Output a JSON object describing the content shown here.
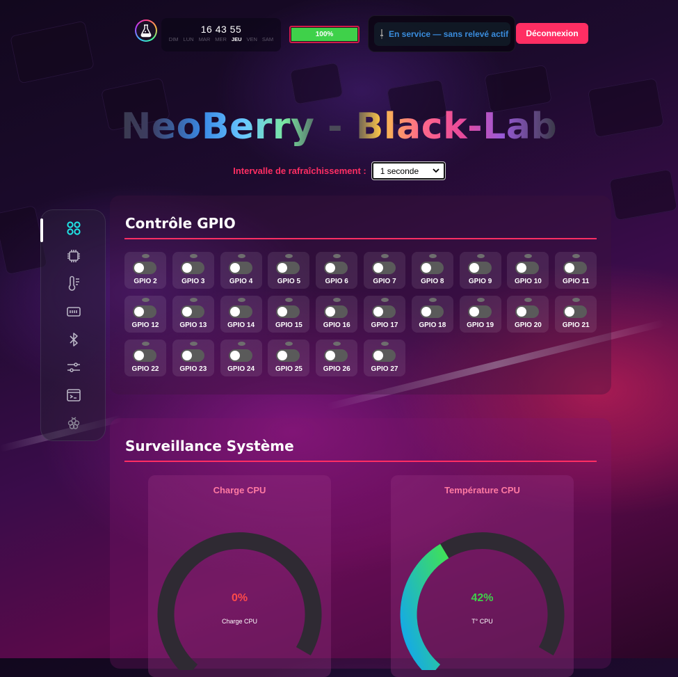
{
  "header": {
    "clock": {
      "time": "16 43 55",
      "days": [
        "DIM",
        "LUN",
        "MAR",
        "MER",
        "JEU",
        "VEN",
        "SAM"
      ],
      "active_day": "JEU"
    },
    "battery": {
      "label": "100%",
      "level": 100
    },
    "status": {
      "text": "En service — sans relevé actif"
    },
    "logout_label": "Déconnexion"
  },
  "title": "NeoBerry - Black-Lab",
  "refresh": {
    "label": "Intervalle de rafraîchissement :",
    "selected": "1 seconde"
  },
  "sidebar": {
    "items": [
      {
        "icon": "dashboard-icon",
        "active": true
      },
      {
        "icon": "chip-icon"
      },
      {
        "icon": "thermometer-icon"
      },
      {
        "icon": "memory-icon"
      },
      {
        "icon": "bluetooth-icon"
      },
      {
        "icon": "sliders-icon"
      },
      {
        "icon": "terminal-icon"
      },
      {
        "icon": "raspberry-icon"
      }
    ]
  },
  "gpio": {
    "title": "Contrôle GPIO",
    "pins": [
      {
        "label": "GPIO 2",
        "on": false
      },
      {
        "label": "GPIO 3",
        "on": false
      },
      {
        "label": "GPIO 4",
        "on": false
      },
      {
        "label": "GPIO 5",
        "on": false
      },
      {
        "label": "GPIO 6",
        "on": false
      },
      {
        "label": "GPIO 7",
        "on": false
      },
      {
        "label": "GPIO 8",
        "on": false
      },
      {
        "label": "GPIO 9",
        "on": false
      },
      {
        "label": "GPIO 10",
        "on": false
      },
      {
        "label": "GPIO 11",
        "on": false
      },
      {
        "label": "GPIO 12",
        "on": false
      },
      {
        "label": "GPIO 13",
        "on": false
      },
      {
        "label": "GPIO 14",
        "on": false
      },
      {
        "label": "GPIO 15",
        "on": false
      },
      {
        "label": "GPIO 16",
        "on": false
      },
      {
        "label": "GPIO 17",
        "on": false
      },
      {
        "label": "GPIO 18",
        "on": false
      },
      {
        "label": "GPIO 19",
        "on": false
      },
      {
        "label": "GPIO 20",
        "on": false
      },
      {
        "label": "GPIO 21",
        "on": false
      },
      {
        "label": "GPIO 22",
        "on": false
      },
      {
        "label": "GPIO 23",
        "on": false
      },
      {
        "label": "GPIO 24",
        "on": false
      },
      {
        "label": "GPIO 25",
        "on": false
      },
      {
        "label": "GPIO 26",
        "on": false
      },
      {
        "label": "GPIO 27",
        "on": false
      }
    ]
  },
  "system": {
    "title": "Surveillance Système",
    "gauges": [
      {
        "title": "Charge CPU",
        "value_text": "0%",
        "value": 0,
        "sublabel": "Charge CPU",
        "value_color": "#ff4a4a"
      },
      {
        "title": "Température CPU",
        "value_text": "42%",
        "value": 42,
        "sublabel": "T° CPU",
        "value_color": "#3fd14a"
      }
    ]
  },
  "colors": {
    "accent": "#ff2e63",
    "battery_fill": "#3fd14a",
    "status_text": "#3a8dde",
    "sidebar_active_icon": "#1fe6e6"
  }
}
